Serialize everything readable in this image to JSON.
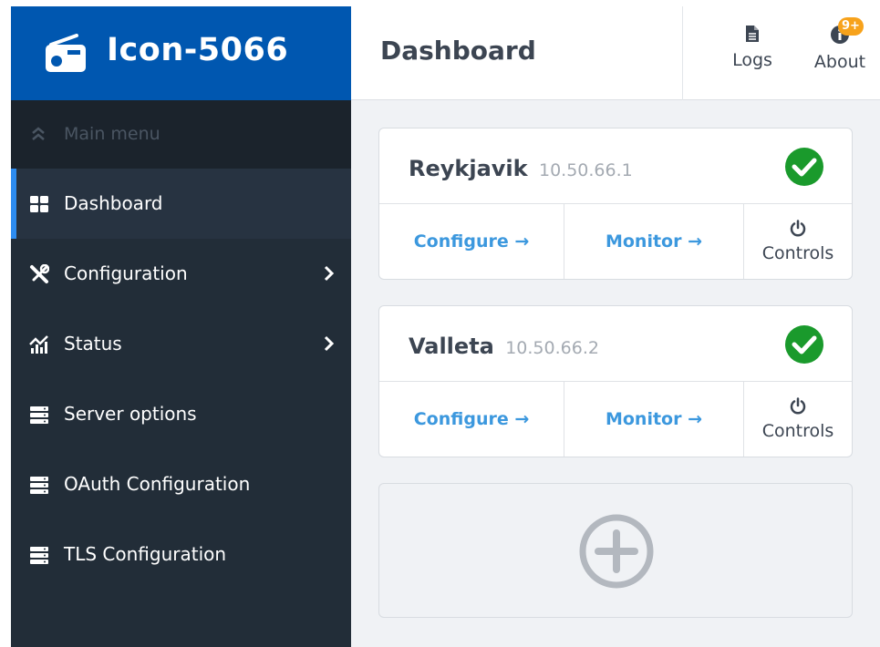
{
  "brand": {
    "title": "Icon-5066",
    "icon": "radio-icon"
  },
  "sidebar": {
    "header_label": "Main menu",
    "items": [
      {
        "label": "Dashboard",
        "icon": "grid-icon",
        "active": true,
        "has_submenu": false
      },
      {
        "label": "Configuration",
        "icon": "tools-icon",
        "active": false,
        "has_submenu": true
      },
      {
        "label": "Status",
        "icon": "chart-icon",
        "active": false,
        "has_submenu": true
      },
      {
        "label": "Server options",
        "icon": "server-icon",
        "active": false,
        "has_submenu": false
      },
      {
        "label": "OAuth Configuration",
        "icon": "server-icon",
        "active": false,
        "has_submenu": false
      },
      {
        "label": "TLS Configuration",
        "icon": "server-icon",
        "active": false,
        "has_submenu": false
      }
    ]
  },
  "header": {
    "title": "Dashboard",
    "logs_label": "Logs",
    "about_label": "About",
    "about_badge": "9+"
  },
  "devices": [
    {
      "name": "Reykjavik",
      "ip": "10.50.66.1",
      "status": "ok",
      "configure_label": "Configure →",
      "monitor_label": "Monitor →",
      "controls_label": "Controls"
    },
    {
      "name": "Valleta",
      "ip": "10.50.66.2",
      "status": "ok",
      "configure_label": "Configure →",
      "monitor_label": "Monitor →",
      "controls_label": "Controls"
    }
  ],
  "colors": {
    "brand": "#0057b0",
    "sidebar": "#222d38",
    "accent": "#2d8cf0",
    "link": "#3c98de",
    "status_ok": "#1a9a2c",
    "badge": "#f7a21b"
  }
}
